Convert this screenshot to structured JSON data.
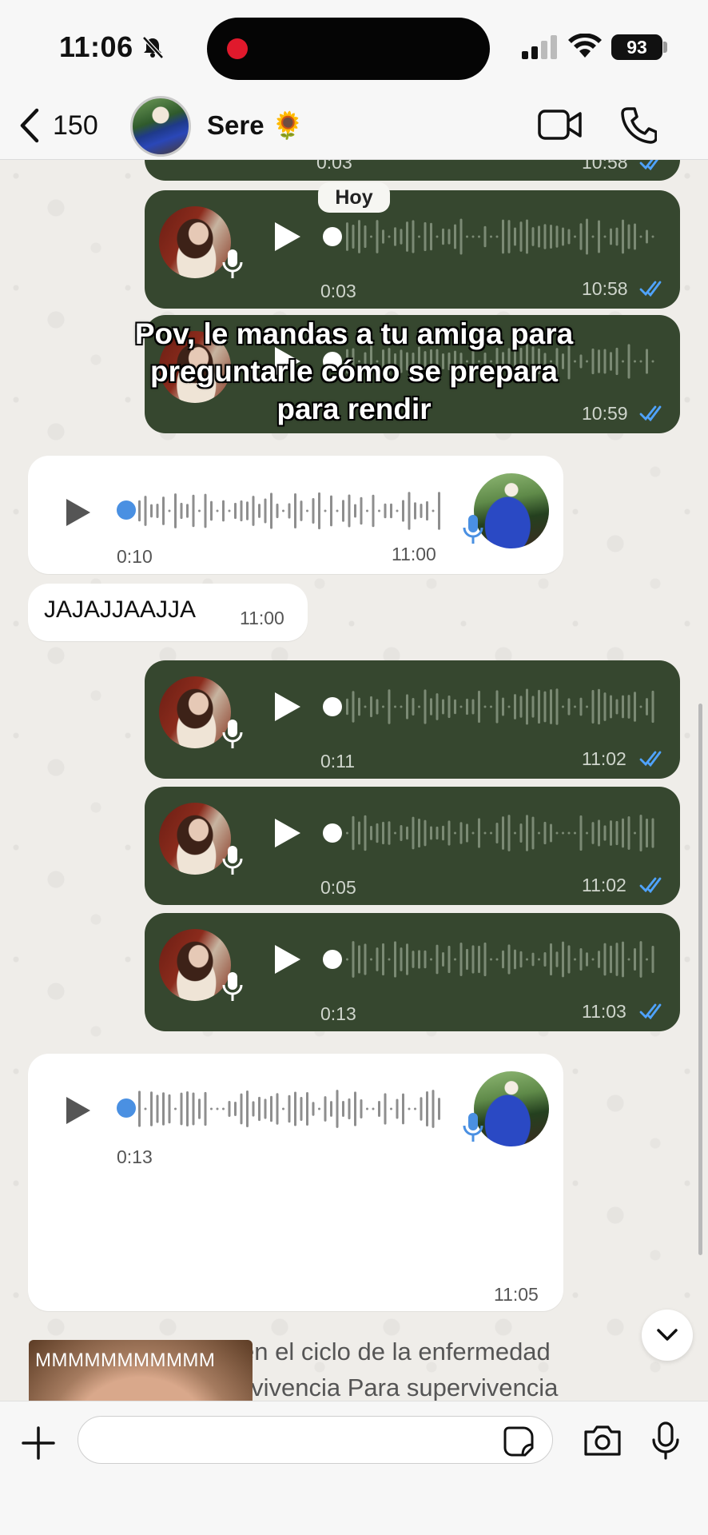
{
  "status_bar": {
    "time": "11:06",
    "battery": "93"
  },
  "header": {
    "back_count": "150",
    "contact_name": "Sere 🌻"
  },
  "chat": {
    "day_label": "Hoy",
    "overlay_caption": "Pov, le mandas a tu amiga para preguntarle cómo se prepara para rendir",
    "messages": [
      {
        "type": "voice-out",
        "duration": "0:03",
        "time": "10:58"
      },
      {
        "type": "voice-out",
        "duration": "0:03",
        "time": "10:58"
      },
      {
        "type": "voice-out",
        "duration": "",
        "time": "10:59"
      },
      {
        "type": "voice-in",
        "duration": "0:10",
        "time": "11:00"
      },
      {
        "type": "text-in",
        "text": "JAJAJJAAJJA",
        "time": "11:00"
      },
      {
        "type": "voice-out",
        "duration": "0:11",
        "time": "11:02"
      },
      {
        "type": "voice-out",
        "duration": "0:05",
        "time": "11:02"
      },
      {
        "type": "voice-out",
        "duration": "0:13",
        "time": "11:03"
      },
      {
        "type": "voice-in",
        "duration": "0:13",
        "time": "11:05",
        "transcript": "\"Sí, __, después en el ciclo de la enfermedad mía, que es supervivencia Para supervivencia Y ya me olvide\""
      }
    ],
    "image_caption": "MMMMMMMMMMM"
  },
  "composer": {
    "placeholder": ""
  },
  "colors": {
    "outgoing_bubble": "#36472f",
    "incoming_bubble": "#ffffff",
    "read_ticks": "#4fa3ff",
    "scrub_dot_in": "#4a90e2"
  }
}
